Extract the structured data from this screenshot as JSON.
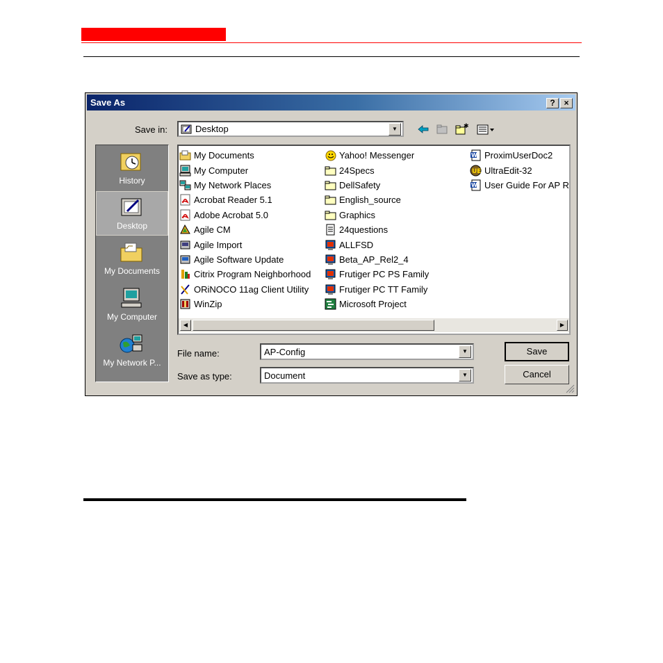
{
  "colors": {
    "red": "#ff0000",
    "title_start": "#0a246a",
    "title_end": "#a6caf0",
    "dialog_bg": "#d4d0c8"
  },
  "dialog": {
    "title": "Save As",
    "help_btn": "?",
    "close_btn": "×",
    "save_in_label": "Save in:",
    "save_in_value": "Desktop"
  },
  "places": [
    {
      "label": "History",
      "icon": "history-icon"
    },
    {
      "label": "Desktop",
      "icon": "desktop-icon"
    },
    {
      "label": "My Documents",
      "icon": "my-documents-icon"
    },
    {
      "label": "My Computer",
      "icon": "my-computer-icon"
    },
    {
      "label": "My Network P...",
      "icon": "network-places-icon"
    }
  ],
  "files": {
    "col1": [
      {
        "name": "My Documents",
        "icon": "folder-docs-icon"
      },
      {
        "name": "My Computer",
        "icon": "computer-icon"
      },
      {
        "name": "My Network Places",
        "icon": "network-icon"
      },
      {
        "name": "Acrobat Reader 5.1",
        "icon": "acrobat-shortcut-icon"
      },
      {
        "name": "Adobe Acrobat 5.0",
        "icon": "acrobat-shortcut-icon"
      },
      {
        "name": "Agile CM",
        "icon": "agile-shortcut-icon"
      },
      {
        "name": "Agile Import",
        "icon": "agile-shortcut-icon"
      },
      {
        "name": "Agile Software Update",
        "icon": "agile-shortcut-icon"
      },
      {
        "name": "Citrix Program Neighborhood",
        "icon": "citrix-icon"
      },
      {
        "name": "ORiNOCO 11ag Client Utility",
        "icon": "orinoco-icon"
      },
      {
        "name": "WinZip",
        "icon": "winzip-icon"
      }
    ],
    "col2": [
      {
        "name": "Yahoo! Messenger",
        "icon": "yahoo-icon"
      },
      {
        "name": "24Specs",
        "icon": "folder-icon"
      },
      {
        "name": "DellSafety",
        "icon": "folder-icon"
      },
      {
        "name": "English_source",
        "icon": "folder-icon"
      },
      {
        "name": "Graphics",
        "icon": "folder-icon"
      },
      {
        "name": "24questions",
        "icon": "text-file-icon"
      },
      {
        "name": "ALLFSD",
        "icon": "framemaker-icon"
      },
      {
        "name": "Beta_AP_Rel2_4",
        "icon": "framemaker-icon"
      },
      {
        "name": "Frutiger PC PS Family",
        "icon": "framemaker-icon"
      },
      {
        "name": "Frutiger PC TT Family",
        "icon": "framemaker-icon"
      },
      {
        "name": "Microsoft Project",
        "icon": "project-icon"
      }
    ],
    "col3": [
      {
        "name": "ProximUserDoc2",
        "icon": "word-doc-icon"
      },
      {
        "name": "UltraEdit-32",
        "icon": "ultraedit-icon"
      },
      {
        "name": "User Guide For AP R",
        "icon": "word-doc-icon"
      }
    ]
  },
  "form": {
    "file_name_label": "File name:",
    "file_name_value": "AP-Config",
    "save_type_label": "Save as type:",
    "save_type_value": "Document",
    "save_label": "Save",
    "cancel_label": "Cancel"
  }
}
